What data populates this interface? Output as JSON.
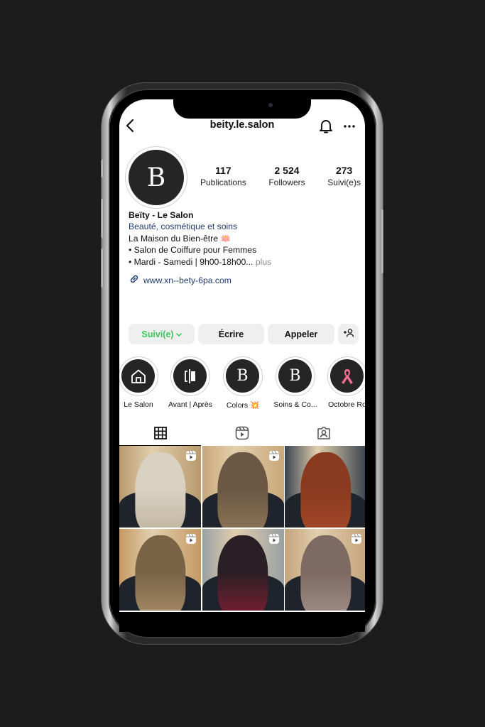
{
  "header": {
    "username": "beity.le.salon",
    "back_icon": "chevron-left",
    "bell_icon": "bell",
    "more_icon": "ellipsis"
  },
  "profile": {
    "avatar_letter": "B",
    "stats": [
      {
        "value": "117",
        "label": "Publications"
      },
      {
        "value": "2 524",
        "label": "Followers"
      },
      {
        "value": "273",
        "label": "Suivi(e)s"
      }
    ],
    "name": "Beïty - Le Salon",
    "category": "Beauté, cosmétique et soins",
    "bio_lines": [
      "La Maison du Bien-être 🪷",
      "• Salon de Coiffure pour Femmes",
      "• Mardi - Samedi | 9h00-18h00..."
    ],
    "more_label": "plus",
    "website": "www.xn--bety-6pa.com"
  },
  "buttons": {
    "follow": "Suivi(e)",
    "message": "Écrire",
    "call": "Appeler"
  },
  "highlights": [
    {
      "label": "Le Salon",
      "icon": "house"
    },
    {
      "label": "Avant | Après",
      "icon": "before-after"
    },
    {
      "label": "Colors 💥",
      "icon": "B"
    },
    {
      "label": "Soins & Co...",
      "icon": "B"
    },
    {
      "label": "Octobre Ro",
      "icon": "pink-ribbon"
    }
  ],
  "tabs": [
    "grid",
    "reels",
    "tagged"
  ],
  "posts": [
    {
      "hair": "#d9d2c3",
      "hair2": "#bfb39c",
      "bg": "#b89a6e",
      "reel": true
    },
    {
      "hair": "#6b5743",
      "hair2": "#8d7558",
      "bg": "#c9a879",
      "reel": true
    },
    {
      "hair": "#8a3a1f",
      "hair2": "#a4492a",
      "bg": "#3a4450",
      "reel": false
    },
    {
      "hair": "#7a6247",
      "hair2": "#a48a66",
      "bg": "#c49a64",
      "reel": true
    },
    {
      "hair": "#2a1f24",
      "hair2": "#7a1f35",
      "bg": "#9aa0a4",
      "reel": true
    },
    {
      "hair": "#7d6a62",
      "hair2": "#a08e86",
      "bg": "#c4a47c",
      "reel": true
    }
  ],
  "colors": {
    "follow_green": "#3cc85a",
    "link_blue": "#1f3a6e",
    "ribbon_pink": "#f06b8c"
  }
}
